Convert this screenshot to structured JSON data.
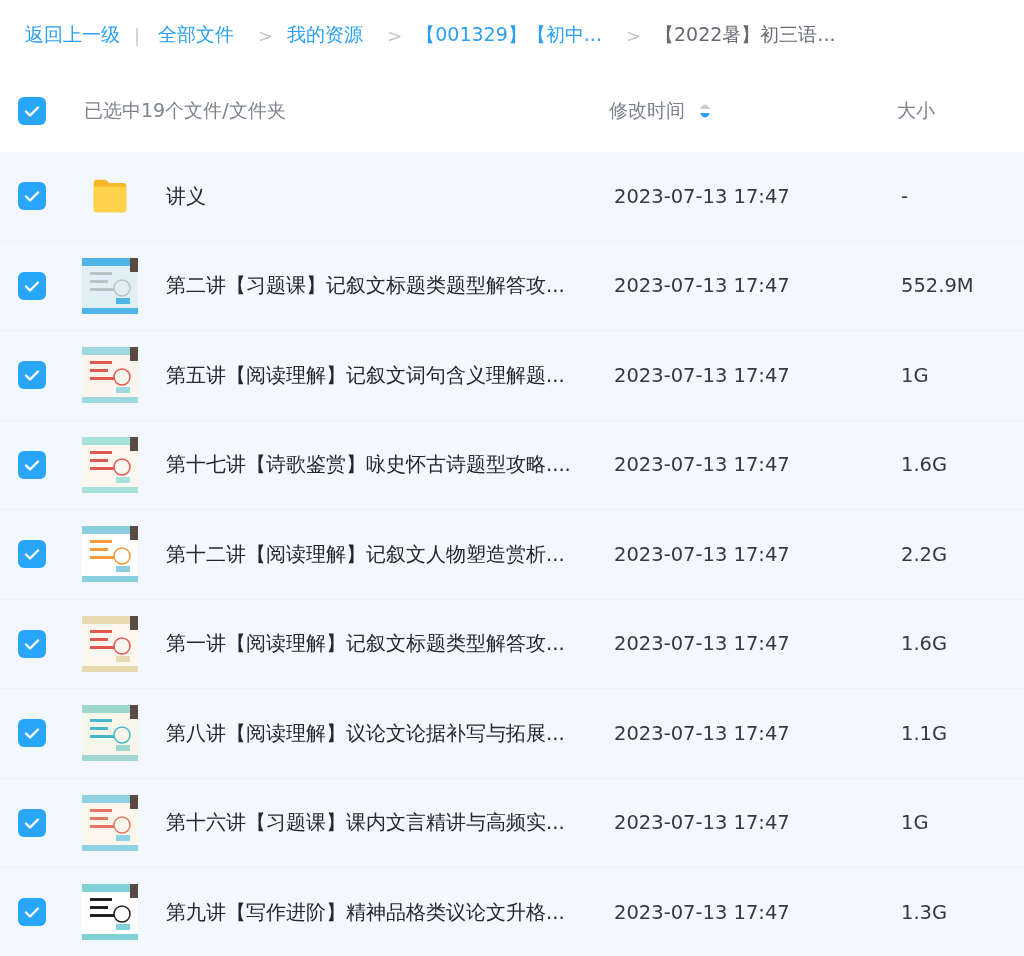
{
  "breadcrumb": {
    "back": "返回上一级",
    "divider": "|",
    "crumbs": [
      {
        "label": "全部文件",
        "separator": ">",
        "current": false
      },
      {
        "label": "我的资源",
        "separator": ">",
        "current": false
      },
      {
        "label": "【001329】【初中...",
        "separator": ">",
        "current": false
      },
      {
        "label": "【2022暑】初三语...",
        "current": true
      }
    ]
  },
  "header": {
    "checked": true,
    "selection": "已选中19个文件/文件夹",
    "columns": [
      {
        "label": "修改时间",
        "sort_descending": true
      },
      {
        "label": "大小"
      }
    ]
  },
  "rows": [
    {
      "kind": "folder",
      "checked": true,
      "name": "讲义",
      "modified": "2023-07-13 17:47",
      "size": "-"
    },
    {
      "kind": "picture",
      "checked": true,
      "name": "第二讲【习题课】记叙文标题类题型解答攻...",
      "modified": "2023-07-13 17:47",
      "size": "552.9M"
    },
    {
      "kind": "picture",
      "checked": true,
      "name": "第五讲【阅读理解】记叙文词句含义理解题...",
      "modified": "2023-07-13 17:47",
      "size": "1G"
    },
    {
      "kind": "picture",
      "checked": true,
      "name": "第十七讲【诗歌鉴赏】咏史怀古诗题型攻略....",
      "modified": "2023-07-13 17:47",
      "size": "1.6G"
    },
    {
      "kind": "picture",
      "checked": true,
      "name": "第十二讲【阅读理解】记叙文人物塑造赏析...",
      "modified": "2023-07-13 17:47",
      "size": "2.2G"
    },
    {
      "kind": "picture",
      "checked": true,
      "name": "第一讲【阅读理解】记叙文标题类型解答攻...",
      "modified": "2023-07-13 17:47",
      "size": "1.6G"
    },
    {
      "kind": "picture",
      "checked": true,
      "name": "第八讲【阅读理解】议论文论据补写与拓展...",
      "modified": "2023-07-13 17:47",
      "size": "1.1G"
    },
    {
      "kind": "picture",
      "checked": true,
      "name": "第十六讲【习题课】课内文言精讲与高频实...",
      "modified": "2023-07-13 17:47",
      "size": "1G"
    },
    {
      "kind": "picture",
      "checked": true,
      "name": "第九讲【写作进阶】精神品格类议论文升格...",
      "modified": "2023-07-13 17:47",
      "size": "1.3G"
    }
  ]
}
